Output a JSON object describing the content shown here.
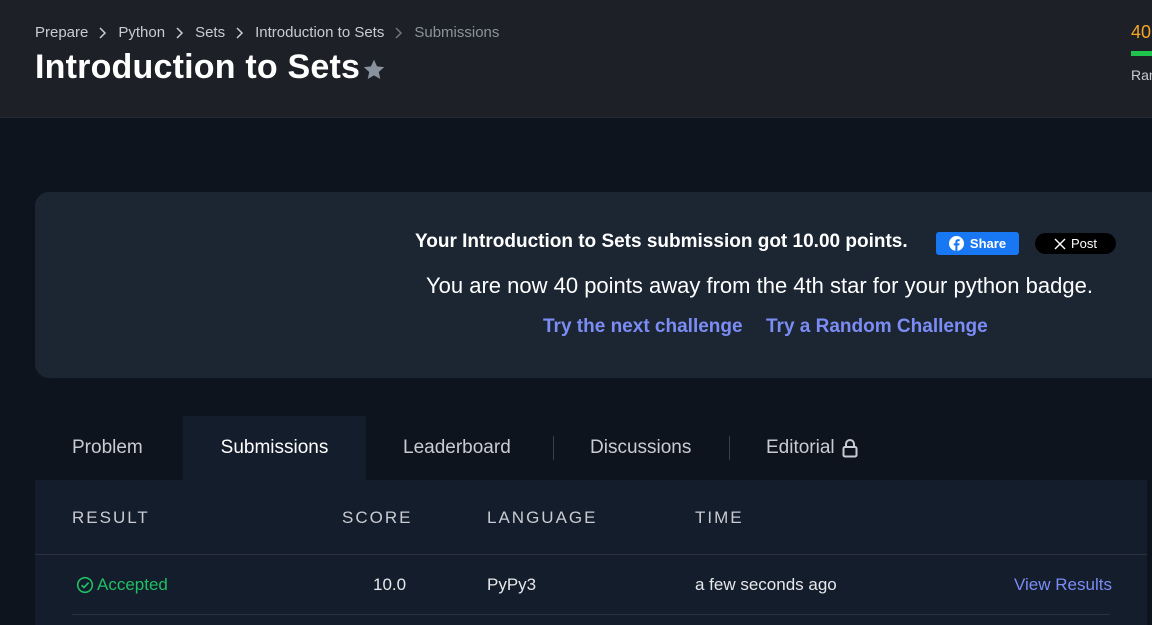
{
  "breadcrumb": {
    "items": [
      "Prepare",
      "Python",
      "Sets",
      "Introduction to Sets"
    ],
    "current": "Submissions"
  },
  "page": {
    "title": "Introduction to Sets"
  },
  "header_peek": {
    "score": "40",
    "rank_label": "Ran"
  },
  "banner": {
    "message": "Your Introduction to Sets submission got 10.00 points.",
    "share_label": "Share",
    "post_label": "Post",
    "badge_message": "You are now 40 points away from the 4th star for your python badge.",
    "next_challenge": "Try the next challenge",
    "random_challenge": "Try a Random Challenge"
  },
  "tabs": [
    {
      "label": "Problem"
    },
    {
      "label": "Submissions",
      "active": true
    },
    {
      "label": "Leaderboard"
    },
    {
      "label": "Discussions"
    },
    {
      "label": "Editorial"
    }
  ],
  "table": {
    "headers": [
      "RESULT",
      "SCORE",
      "LANGUAGE",
      "TIME"
    ],
    "rows": [
      {
        "result": "Accepted",
        "score": "10.0",
        "language": "PyPy3",
        "time": "a few seconds ago",
        "action": "View Results"
      }
    ]
  },
  "colors": {
    "background": "#0e141e",
    "header": "#1e2028",
    "banner": "#1c2633",
    "link": "#7b8cf5",
    "accepted": "#1fbf63",
    "score": "#f5a623",
    "facebook": "#1877f2"
  },
  "icons": [
    "chevron-right-icon",
    "star-icon",
    "facebook-icon",
    "x-logo-icon",
    "lock-icon",
    "check-circle-icon"
  ]
}
